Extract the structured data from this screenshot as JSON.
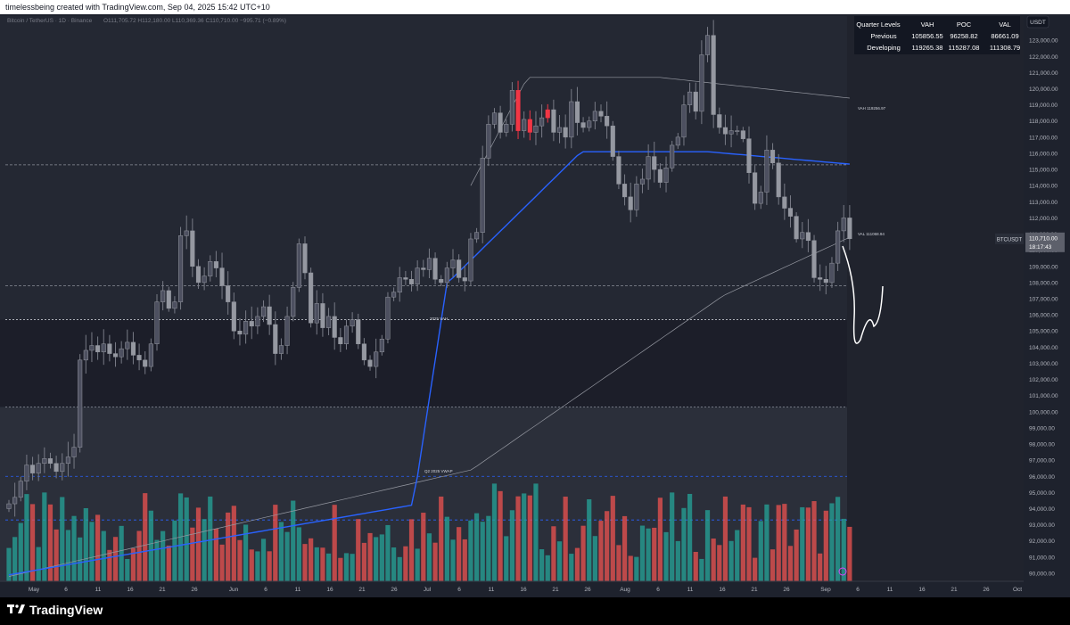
{
  "header": {
    "credit": "timelessbeing created with TradingView.com, Sep 04, 2025 15:42 UTC+10",
    "symbol_line": "Bitcoin / TetherUS · 1D · Binance",
    "ohlc": "O111,705.72 H112,180.00 L110,369.36 C110,710.00 −995.71 (−0.89%)"
  },
  "quarter_table": {
    "headers": [
      "Quarter Levels",
      "VAH",
      "POC",
      "VAL"
    ],
    "rows": [
      [
        "Previous",
        "105856.55",
        "96258.82",
        "86661.09"
      ],
      [
        "Developing",
        "119265.38",
        "115287.08",
        "111308.79"
      ]
    ]
  },
  "annotations": {
    "vah_label": "VAH 119256.97",
    "val_label": "VAL 111068.94",
    "yearly_vah_label": "2025 VAH",
    "vwap_label": "Q2 2025 VWAP"
  },
  "price_axis": {
    "currency": "USDT",
    "symbol_tag": "BTCUSDT",
    "last_price": "110,710.00",
    "countdown": "18:17:43"
  },
  "footer": {
    "brand": "TradingView"
  },
  "colors": {
    "background": "#1e222d",
    "up": "#26a69a",
    "down": "#ef5350",
    "candle": "#787b86",
    "highlight": "#f23645",
    "vwap": "#2962ff"
  },
  "chart_data": {
    "type": "candlestick",
    "ylim": [
      89500,
      124500
    ],
    "y_ticks": [
      "90,000.00",
      "91,000.00",
      "92,000.00",
      "93,000.00",
      "94,000.00",
      "95,000.00",
      "96,000.00",
      "97,000.00",
      "98,000.00",
      "99,000.00",
      "100,000.00",
      "101,000.00",
      "102,000.00",
      "103,000.00",
      "104,000.00",
      "105,000.00",
      "106,000.00",
      "107,000.00",
      "108,000.00",
      "109,000.00",
      "110,000.00",
      "111,000.00",
      "112,000.00",
      "113,000.00",
      "114,000.00",
      "115,000.00",
      "116,000.00",
      "117,000.00",
      "118,000.00",
      "119,000.00",
      "120,000.00",
      "121,000.00",
      "122,000.00",
      "123,000.00",
      "124,000.00"
    ],
    "x_ticks": [
      "May",
      "6",
      "11",
      "16",
      "21",
      "26",
      "Jun",
      "6",
      "11",
      "16",
      "21",
      "26",
      "Jul",
      "6",
      "11",
      "16",
      "21",
      "26",
      "Aug",
      "6",
      "11",
      "16",
      "21",
      "26",
      "Sep",
      "6",
      "11",
      "16",
      "21",
      "26",
      "Oct"
    ],
    "levels": {
      "prev_vah": 105856.55,
      "prev_poc": 96258.82,
      "prev_val": 86661.09,
      "dev_vah": 119265.38,
      "dev_poc": 115287.08,
      "dev_val": 111308.79,
      "yearly_vah": 105700,
      "zone_high": 100300,
      "q2_vwap": 96000,
      "dotted_low": 93300,
      "dotted_mid": 107800
    },
    "close": [
      94300,
      94700,
      95700,
      96700,
      96200,
      96800,
      97100,
      96800,
      96300,
      96800,
      97200,
      97800,
      103200,
      103800,
      104100,
      103700,
      104200,
      103600,
      103400,
      103900,
      104300,
      103500,
      103200,
      102800,
      104200,
      106800,
      107500,
      106400,
      106800,
      110900,
      111200,
      109000,
      108000,
      108400,
      109300,
      108900,
      107800,
      106800,
      105000,
      104800,
      105600,
      105300,
      105900,
      106500,
      105400,
      103600,
      104100,
      105900,
      107700,
      110400,
      108600,
      105500,
      106700,
      105200,
      105900,
      104600,
      104200,
      105300,
      105700,
      104200,
      103200,
      102800,
      103700,
      104500,
      107100,
      107400,
      108300,
      108200,
      107900,
      108900,
      108800,
      109500,
      108200,
      108000,
      108900,
      109400,
      108300,
      108100,
      110700,
      111100,
      115700,
      117800,
      118500,
      117300,
      117800,
      119900,
      117400,
      118100,
      117300,
      117700,
      118200,
      118700,
      117300,
      117600,
      117000,
      119200,
      117900,
      117600,
      118000,
      118600,
      118300,
      117700,
      115800,
      114100,
      113300,
      112500,
      114100,
      114400,
      115800,
      115000,
      114200,
      115100,
      116500,
      117000,
      119000,
      119800,
      118600,
      122100,
      123300,
      118400,
      117600,
      117200,
      117400,
      117400,
      116900,
      114800,
      112900,
      113600,
      116200,
      115400,
      113300,
      112600,
      112100,
      110700,
      111100,
      110600,
      108300,
      108200,
      108000,
      109200,
      111200,
      112000,
      110710
    ],
    "volume_scale": 100
  }
}
